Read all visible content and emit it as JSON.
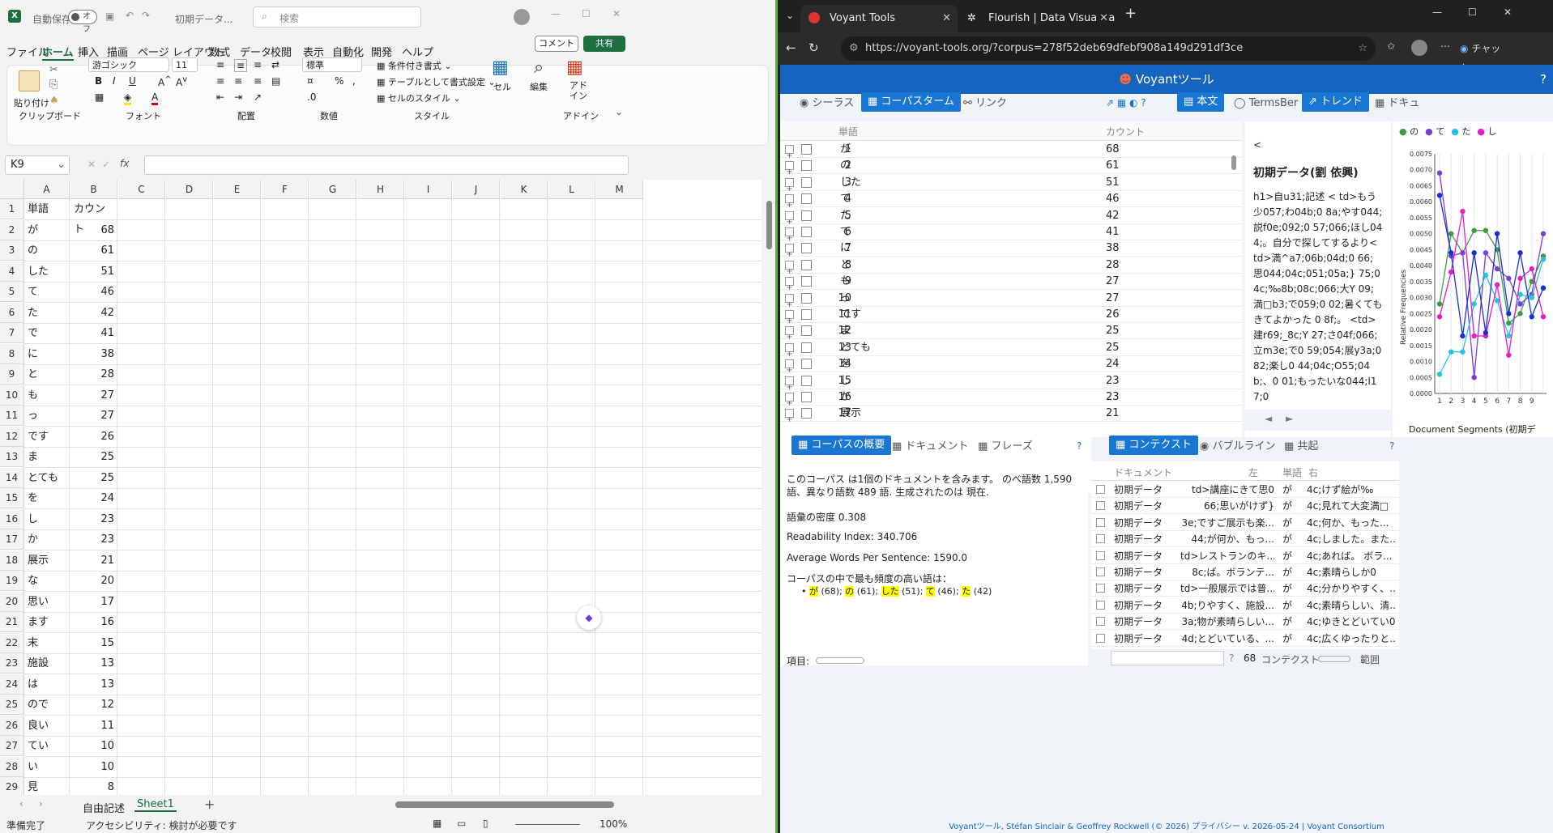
{
  "excel": {
    "autosave_label": "自動保存",
    "autosave_state": "オフ",
    "file_title": "初期データ...",
    "search_placeholder": "検索",
    "ribbon_tabs": [
      "ファイル",
      "ホーム",
      "挿入",
      "描画",
      "ページ レイアウト",
      "数式",
      "データ",
      "校閲",
      "表示",
      "自動化",
      "開発",
      "ヘルプ"
    ],
    "comment_label": "コメント",
    "share_label": "共有",
    "paste_label": "貼り付け",
    "clipboard_label": "クリップボード",
    "font_name": "游ゴシック",
    "font_size": "11",
    "font_label": "フォント",
    "align_label": "配置",
    "number_format": "標準",
    "number_label": "数値",
    "cond_format": "条件付き書式",
    "table_format": "テーブルとして書式設定",
    "cell_style": "セルのスタイル",
    "style_label": "スタイル",
    "cell_label": "セル",
    "edit_label": "編集",
    "addin_label": "アド\nイン",
    "addin_group": "アドイン",
    "name_box": "K9",
    "columns": [
      "A",
      "B",
      "C",
      "D",
      "E",
      "F",
      "G",
      "H",
      "I",
      "J",
      "K",
      "L",
      "M"
    ],
    "rows": [
      [
        "単語",
        "カウント"
      ],
      [
        "が",
        "68"
      ],
      [
        "の",
        "61"
      ],
      [
        "した",
        "51"
      ],
      [
        "て",
        "46"
      ],
      [
        "た",
        "42"
      ],
      [
        "で",
        "41"
      ],
      [
        "に",
        "38"
      ],
      [
        "と",
        "28"
      ],
      [
        "も",
        "27"
      ],
      [
        "っ",
        "27"
      ],
      [
        "です",
        "26"
      ],
      [
        "ま",
        "25"
      ],
      [
        "とても",
        "25"
      ],
      [
        "を",
        "24"
      ],
      [
        "し",
        "23"
      ],
      [
        "か",
        "23"
      ],
      [
        "展示",
        "21"
      ],
      [
        "な",
        "20"
      ],
      [
        "思い",
        "17"
      ],
      [
        "ます",
        "16"
      ],
      [
        "末",
        "15"
      ],
      [
        "施設",
        "13"
      ],
      [
        "は",
        "13"
      ],
      [
        "ので",
        "12"
      ],
      [
        "良い",
        "11"
      ],
      [
        "てい",
        "10"
      ],
      [
        "い",
        "10"
      ],
      [
        "見",
        "8"
      ]
    ],
    "sheet_tabs": [
      "自由記述",
      "Sheet1"
    ],
    "status_ready": "準備完了",
    "status_accessibility": "アクセシビリティ: 検討が必要です",
    "zoom": "100%"
  },
  "browser": {
    "tabs": [
      {
        "title": "Voyant Tools"
      },
      {
        "title": "Flourish | Data Visualization & Stor"
      }
    ],
    "url": "https://voyant-tools.org/?corpus=278f52deb69dfebf908a149d291df3ce",
    "chat_label": "チャット"
  },
  "voyant": {
    "title": "Voyantツール",
    "tools_left": [
      "シーラス",
      "コーパスターム",
      "リンク"
    ],
    "tools_mid": [
      "本文",
      "TermsBer",
      "トレンド",
      "ドキュ"
    ],
    "terms_header": [
      "単語",
      "カウント"
    ],
    "terms": [
      [
        "1",
        "が",
        "68"
      ],
      [
        "2",
        "の",
        "61"
      ],
      [
        "3",
        "した",
        "51"
      ],
      [
        "4",
        "て",
        "46"
      ],
      [
        "5",
        "た",
        "42"
      ],
      [
        "6",
        "で",
        "41"
      ],
      [
        "7",
        "に",
        "38"
      ],
      [
        "8",
        "と",
        "28"
      ],
      [
        "9",
        "も",
        "27"
      ],
      [
        "10",
        "っ",
        "27"
      ],
      [
        "11",
        "です",
        "26"
      ],
      [
        "12",
        "ま",
        "25"
      ],
      [
        "13",
        "とても",
        "25"
      ],
      [
        "14",
        "を",
        "24"
      ],
      [
        "15",
        "し",
        "23"
      ],
      [
        "16",
        "か",
        "23"
      ],
      [
        "17",
        "展示",
        "21"
      ]
    ],
    "terms_total": "489",
    "reader_title": "初期データ(劉 依興)",
    "reader_lt": "<",
    "reader_text": "h1>自u31;記述 < td>もう少057;わ04b;0 8a;やす044;説f0e;092;0 57;066;ほし044;。自分で探してするより< td>満^a7;06b;04d;0 66;思044;04c;051;05a;} 75;04c;‰8b;08c;066;大Y 09;満□b3;で059;0 02;暑くてもきてよかった 0 8f;。 <td>建r69;_8c;Y 27;さ04f;066;立m3e;で0 59;054;展y3a;082;楽し0 44;04c;O55;04b;、0 01;もったいな044;I17;0",
    "trend_legend": [
      "の",
      "て",
      "た",
      "し"
    ],
    "trend_ylabel": "Relative Frequencies",
    "trend_xlabel": "Document Segments (初期デ",
    "trend_yticks": [
      "0.0075",
      "0.0070",
      "0.0065",
      "0.0060",
      "0.0055",
      "0.0050",
      "0.0045",
      "0.0040",
      "0.0035",
      "0.0030",
      "0.0025",
      "0.0020",
      "0.0015",
      "0.0010",
      "0.0005",
      "0.0000"
    ],
    "trend_xticks": [
      "1",
      "2",
      "3",
      "4",
      "5",
      "6",
      "7",
      "8",
      "9"
    ],
    "bottom_tabs_left": [
      "コーパスの概要",
      "ドキュメント",
      "フレーズ"
    ],
    "bottom_tabs_right": [
      "コンテクスト",
      "バブルライン",
      "共起"
    ],
    "summary_line1": "このコーパス は1個のドキュメントを含みます。 のべ語数 1,590 語、異なり語数 489 語. 生成されたのは 現在.",
    "density": "語彙の密度 0.308",
    "readability": "Readability Index: 340.706",
    "avg_words": "Average Words Per Sentence: 1590.0",
    "frequent_label": "コーパスの中で最も頻度の高い語は：",
    "frequent": [
      [
        "が",
        "(68)"
      ],
      [
        "の",
        "(61)"
      ],
      [
        "した",
        "(51)"
      ],
      [
        "て",
        "(46)"
      ],
      [
        "た",
        "(42)"
      ]
    ],
    "items_label": "項目:",
    "ctx_header": [
      "ドキュメント",
      "左",
      "単語",
      "右"
    ],
    "ctx_rows": [
      [
        "初期データ",
        "td>講座にきて思0",
        "が",
        "4c;けず絵が‰"
      ],
      [
        "初期データ",
        "66;思いがけず}",
        "が",
        "4c;見れて大変満□"
      ],
      [
        "初期データ",
        "3e;ですご展示も楽...",
        "が",
        "4c;何か、もった..."
      ],
      [
        "初期データ",
        "44;が何か、もっ...",
        "が",
        "4c;しました。また..."
      ],
      [
        "初期データ",
        "td>レストランのキ...",
        "が",
        "4c;あれば。 ボラ..."
      ],
      [
        "初期データ",
        "8c;ば。ボランテ...",
        "が",
        "4c;素晴らしか0"
      ],
      [
        "初期データ",
        "td>一般展示では普...",
        "が",
        "4c;分かりやすく、..."
      ],
      [
        "初期データ",
        "4b;りやすく、施設...",
        "が",
        "4c;素晴らしい、清..."
      ],
      [
        "初期データ",
        "3a;物が素晴らしい...",
        "が",
        "4c;ゆきとどいてい0"
      ],
      [
        "初期データ",
        "4d;とどいている、...",
        "が",
        "4c;広くゆったりと..."
      ]
    ],
    "ctx_count": "68",
    "ctx_label": "コンテクスト",
    "range_label": "範囲",
    "footer": "Voyantツール, Stéfan Sinclair & Geoffrey Rockwell (© 2026) プライバシー v. 2026-05-24 | Voyant Consortium"
  },
  "chart_data": {
    "type": "line",
    "title": "",
    "xlabel": "Document Segments (初期デ",
    "ylabel": "Relative Frequencies",
    "ylim": [
      0,
      0.0075
    ],
    "x": [
      1,
      2,
      3,
      4,
      5,
      6,
      7,
      8,
      9,
      10
    ],
    "series": [
      {
        "name": "の",
        "color": "#3e9a3e",
        "values": [
          0.0028,
          0.005,
          0.0044,
          0.0051,
          0.0051,
          0.0045,
          0.0022,
          0.0025,
          0.0035,
          0.0043
        ]
      },
      {
        "name": "て",
        "color": "#7b3fd6",
        "values": [
          0.0069,
          0.0043,
          0.0044,
          0.0005,
          0.0044,
          0.0039,
          0.0036,
          0.0028,
          0.0031,
          0.005
        ]
      },
      {
        "name": "た",
        "color": "#22c4e0",
        "values": [
          0.0006,
          0.0013,
          0.0013,
          0.0028,
          0.0037,
          0.0029,
          0.0018,
          0.0031,
          0.003,
          0.0042
        ]
      },
      {
        "name": "し",
        "color": "#e020c0",
        "values": [
          0.0024,
          0.0038,
          0.0057,
          0.0018,
          0.0018,
          0.0034,
          0.0012,
          0.0036,
          0.0039,
          0.0024
        ]
      },
      {
        "name": "",
        "color": "#1a2fcf",
        "values": [
          0.0062,
          0.0044,
          0.0018,
          0.0044,
          0.0019,
          0.005,
          0.0025,
          0.0044,
          0.0024,
          0.0033
        ]
      }
    ]
  }
}
